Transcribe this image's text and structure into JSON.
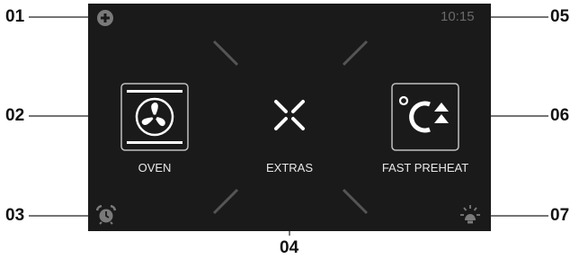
{
  "callouts": {
    "c01": "01",
    "c02": "02",
    "c03": "03",
    "c04": "04",
    "c05": "05",
    "c06": "06",
    "c07": "07"
  },
  "screen": {
    "time": "10:15",
    "tiles": {
      "oven": {
        "label": "OVEN",
        "icon": "fan-icon"
      },
      "extras": {
        "label": "EXTRAS",
        "icon": "extras-icon"
      },
      "fast_preheat": {
        "label": "FAST PREHEAT",
        "icon": "fast-preheat-icon"
      }
    },
    "top_left_icon": "add-icon",
    "bottom_left_icon": "alarm-clock-icon",
    "bottom_right_icon": "light-icon"
  },
  "colors": {
    "screen_bg": "#1a1a1a",
    "text": "#e8e8e8",
    "icon_dim": "#7a7a7a",
    "time": "#6a6a6a"
  }
}
